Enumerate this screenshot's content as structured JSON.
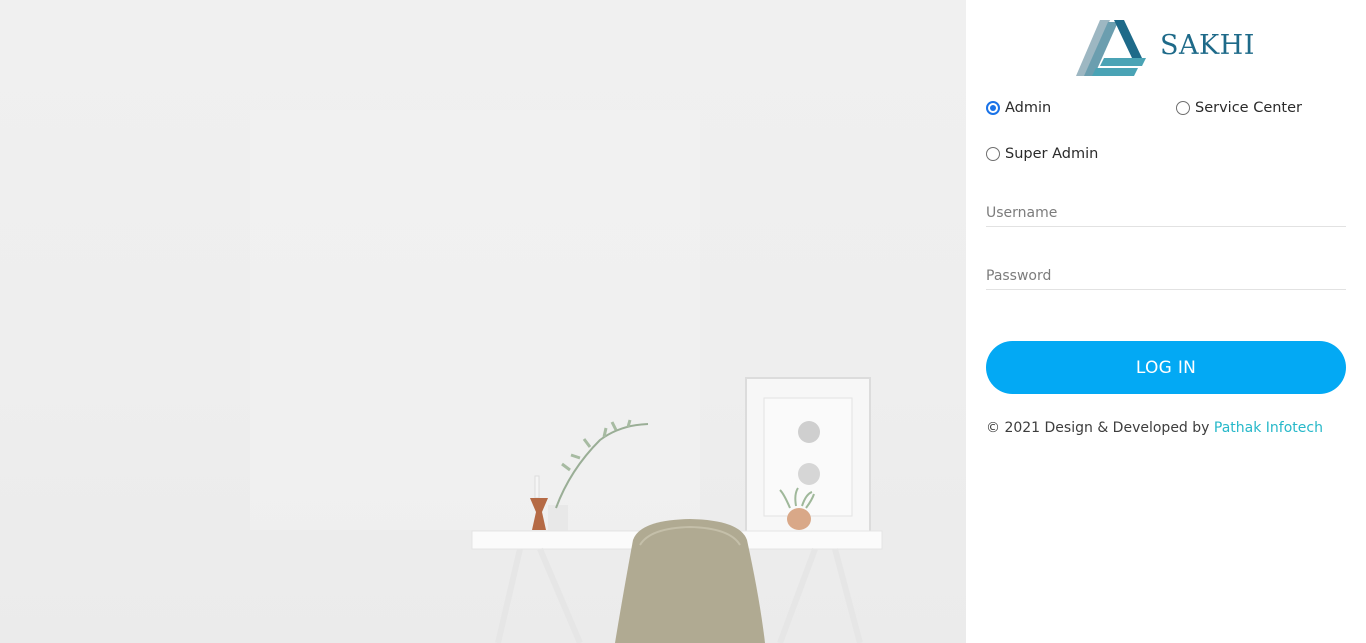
{
  "brand": {
    "name": "SAKHI",
    "logo_colors": [
      "#1e6a89",
      "#4aa3b5",
      "#9db7c2"
    ]
  },
  "login": {
    "roles": [
      {
        "label": "Admin",
        "selected": true
      },
      {
        "label": "Service Center",
        "selected": false
      },
      {
        "label": "Super Admin",
        "selected": false
      }
    ],
    "username": {
      "placeholder": "Username",
      "value": ""
    },
    "password": {
      "placeholder": "Password",
      "value": ""
    },
    "submit_label": "LOG IN"
  },
  "footer": {
    "prefix": "© 2021 Design & Developed by",
    "link_text": "Pathak Infotech"
  },
  "colors": {
    "accent": "#03a9f4",
    "link": "#26b8c9",
    "radio": "#1a73e8"
  }
}
